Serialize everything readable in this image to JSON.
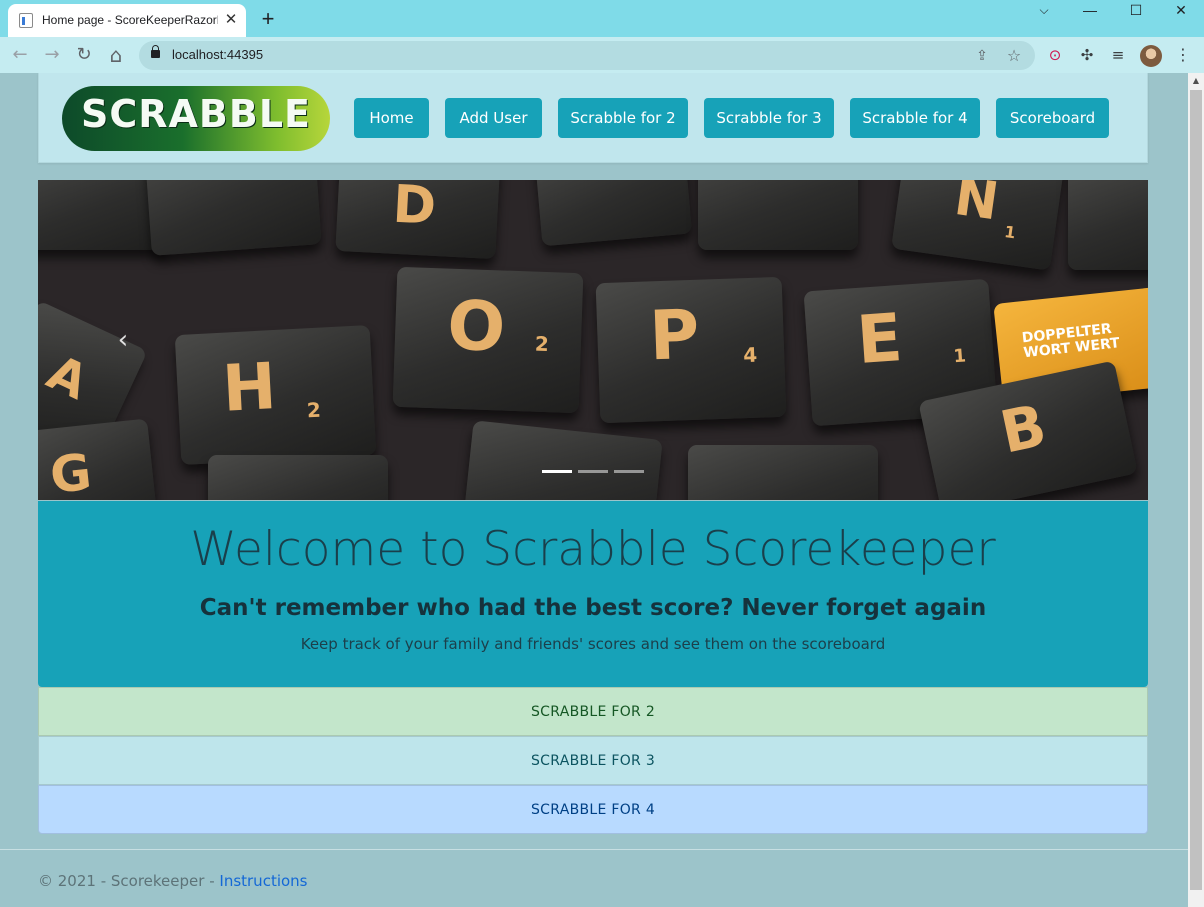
{
  "browser": {
    "tab_title": "Home page - ScoreKeeperRazorP",
    "close_glyph": "✕",
    "newtab_glyph": "+",
    "url": "localhost:44395",
    "window_controls": {
      "chevron": "⌵",
      "minimize": "—",
      "maximize": "☐",
      "close": "✕"
    },
    "nav_icons": {
      "back": "←",
      "forward": "→",
      "reload": "↻",
      "home": "⌂"
    },
    "omnibox_icons": [
      "share-icon",
      "bookmark-star-icon"
    ],
    "extension_icons": [
      "record-extension-icon",
      "puzzle-extensions-icon",
      "reading-list-icon"
    ]
  },
  "site": {
    "logo_text": "SCRABBLE",
    "nav": [
      "Home",
      "Add User",
      "Scrabble for 2",
      "Scrabble for 3",
      "Scrabble for 4",
      "Scoreboard"
    ]
  },
  "carousel": {
    "tiles": [
      {
        "letter": "H",
        "score": "2"
      },
      {
        "letter": "O",
        "score": "2"
      },
      {
        "letter": "P",
        "score": "4"
      },
      {
        "letter": "E",
        "score": "1"
      },
      {
        "letter": "B",
        "score": ""
      },
      {
        "letter": "D",
        "score": ""
      },
      {
        "letter": "N",
        "score": "1"
      },
      {
        "letter": "G",
        "score": ""
      },
      {
        "letter": "A",
        "score": ""
      }
    ],
    "premium_tile_text": "DOPPELTER WORT WERT",
    "indicators": [
      true,
      false,
      false
    ]
  },
  "jumbotron": {
    "title": "Welcome to Scrabble Scorekeeper",
    "subtitle": "Can't remember who had the best score? Never forget again",
    "lead": "Keep track of your family and friends' scores and see them on the scoreboard"
  },
  "game_links": [
    {
      "label": "SCRABBLE FOR 2",
      "bg": "#c3e6cb",
      "fg": "#155724"
    },
    {
      "label": "SCRABBLE FOR 3",
      "bg": "#bee5eb",
      "fg": "#0c5460"
    },
    {
      "label": "SCRABBLE FOR 4",
      "bg": "#b8daff",
      "fg": "#004085"
    }
  ],
  "footer": {
    "copyright": "© 2021 - Scorekeeper - ",
    "link": "Instructions"
  },
  "colors": {
    "page_bg": "#9cc4ca",
    "accent": "#17a2b8",
    "header_bg": "#c0e6ed",
    "tile_letter": "#e5b06b"
  }
}
